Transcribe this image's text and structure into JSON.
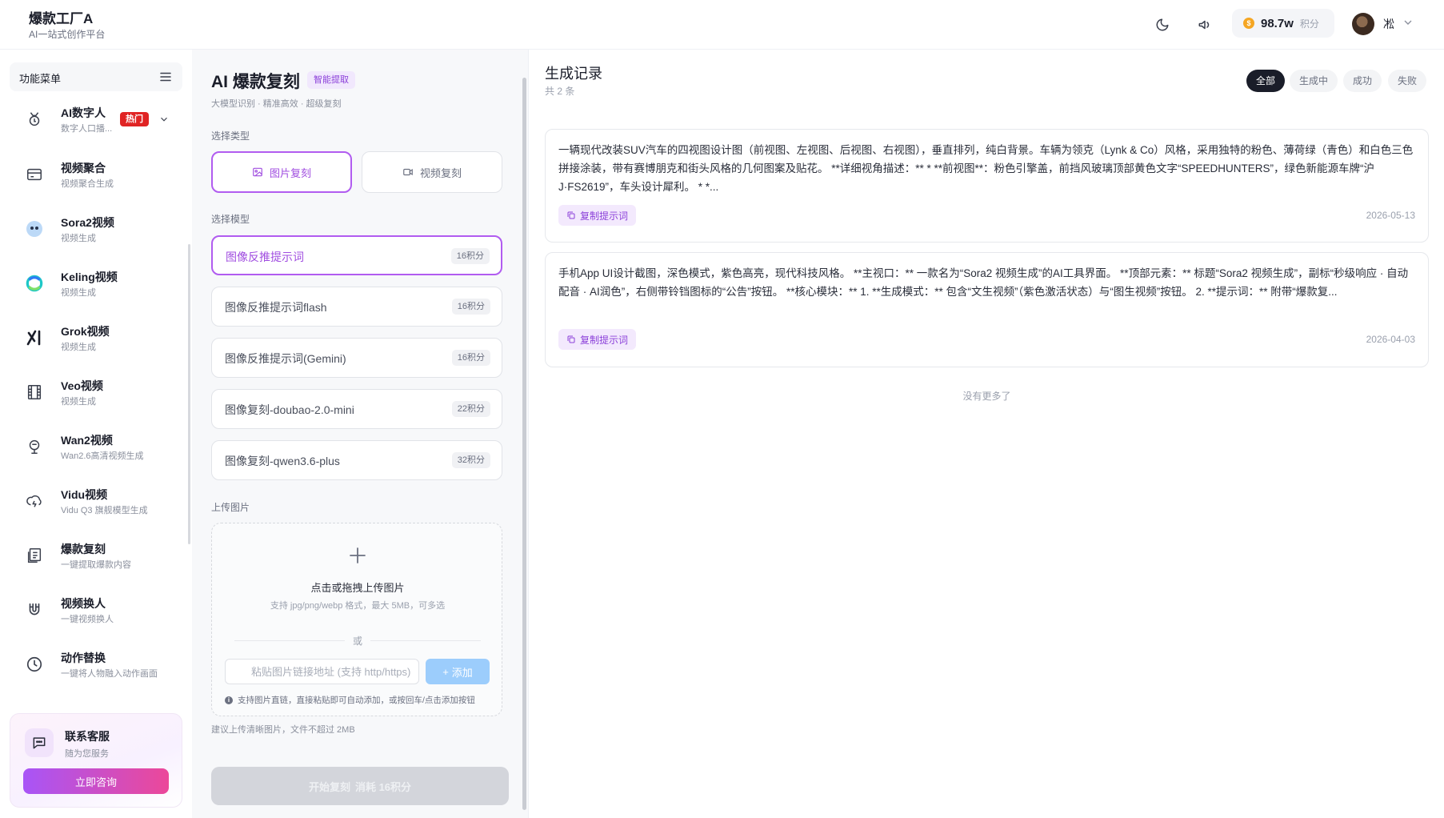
{
  "brand": {
    "title": "爆款工厂A",
    "subtitle": "AI一站式创作平台"
  },
  "header": {
    "points_value": "98.7w",
    "points_unit": "积分",
    "coin_glyph": "$",
    "user_name": "凇"
  },
  "sidebar": {
    "menu_title": "功能菜单",
    "hot_label": "热门",
    "items": [
      {
        "title": "AI数字人",
        "sub": "数字人口播...",
        "icon": "digital-human-icon"
      },
      {
        "title": "视频聚合",
        "sub": "视频聚合生成",
        "icon": "card-icon"
      },
      {
        "title": "Sora2视频",
        "sub": "视频生成",
        "icon": "sora-icon"
      },
      {
        "title": "Keling视频",
        "sub": "视频生成",
        "icon": "keling-icon"
      },
      {
        "title": "Grok视频",
        "sub": "视频生成",
        "icon": "grok-icon"
      },
      {
        "title": "Veo视频",
        "sub": "视频生成",
        "icon": "film-icon"
      },
      {
        "title": "Wan2视频",
        "sub": "Wan2.6高清视频生成",
        "icon": "wan-icon"
      },
      {
        "title": "Vidu视频",
        "sub": "Vidu Q3 旗舰模型生成",
        "icon": "cloud-icon"
      },
      {
        "title": "爆款复刻",
        "sub": "一键提取爆款内容",
        "icon": "copy-doc-icon"
      },
      {
        "title": "视频换人",
        "sub": "一键视频换人",
        "icon": "magnet-icon"
      },
      {
        "title": "动作替换",
        "sub": "一键将人物融入动作画面",
        "icon": "clock-icon"
      }
    ],
    "support": {
      "title": "联系客服",
      "sub": "随为您服务",
      "button": "立即咨询"
    }
  },
  "form": {
    "title": "AI 爆款复刻",
    "tag": "智能提取",
    "subtitle": "大模型识别 · 精准高效 · 超级复刻",
    "type_label": "选择类型",
    "types": [
      {
        "label": "图片复刻",
        "active": true
      },
      {
        "label": "视频复刻",
        "active": false
      }
    ],
    "model_label": "选择模型",
    "models": [
      {
        "name": "图像反推提示词",
        "cost": "16积分",
        "active": true
      },
      {
        "name": "图像反推提示词flash",
        "cost": "16积分",
        "active": false
      },
      {
        "name": "图像反推提示词(Gemini)",
        "cost": "16积分",
        "active": false
      },
      {
        "name": "图像复刻-doubao-2.0-mini",
        "cost": "22积分",
        "active": false
      },
      {
        "name": "图像复刻-qwen3.6-plus",
        "cost": "32积分",
        "active": false
      }
    ],
    "upload_label": "上传图片",
    "upload_main": "点击或拖拽上传图片",
    "upload_hint": "支持 jpg/png/webp 格式，最大 5MB，可多选",
    "or_text": "或",
    "url_placeholder": "粘贴图片链接地址 (支持 http/https)",
    "add_button": "添加",
    "tip": "支持图片直链，直接粘贴即可自动添加，或按回车/点击添加按钮",
    "tip_glyph": "i",
    "file_note": "建议上传清晰图片，文件不超过 2MB",
    "start_button": "开始复刻",
    "start_cost": "消耗 16积分"
  },
  "records": {
    "title": "生成记录",
    "count": "共 2 条",
    "filters": [
      {
        "label": "全部",
        "active": true
      },
      {
        "label": "生成中",
        "active": false
      },
      {
        "label": "成功",
        "active": false
      },
      {
        "label": "失败",
        "active": false
      }
    ],
    "items": [
      {
        "text": "一辆现代改装SUV汽车的四视图设计图（前视图、左视图、后视图、右视图），垂直排列，纯白背景。车辆为领克（Lynk & Co）风格，采用独特的粉色、薄荷绿（青色）和白色三色拼接涂装，带有赛博朋克和街头风格的几何图案及贴花。 **详细视角描述：** * **前视图**：粉色引擎盖，前挡风玻璃顶部黄色文字“SPEEDHUNTERS”，绿色新能源车牌“沪J·FS2619”，车头设计犀利。 * *...",
        "copy_label": "复制提示词",
        "date": "2026-05-13"
      },
      {
        "text": "手机App UI设计截图，深色模式，紫色高亮，现代科技风格。 **主视口：** 一款名为“Sora2 视频生成”的AI工具界面。 **顶部元素：** 标题“Sora2 视频生成”，副标“秒级响应 · 自动配音 · AI润色”，右侧带铃铛图标的“公告”按钮。 **核心模块：** 1. **生成模式：** 包含“文生视频”（紫色激活状态）与“图生视频”按钮。 2. **提示词：** 附带“爆款复...",
        "copy_label": "复制提示词",
        "date": "2026-04-03"
      }
    ],
    "no_more": "没有更多了"
  }
}
